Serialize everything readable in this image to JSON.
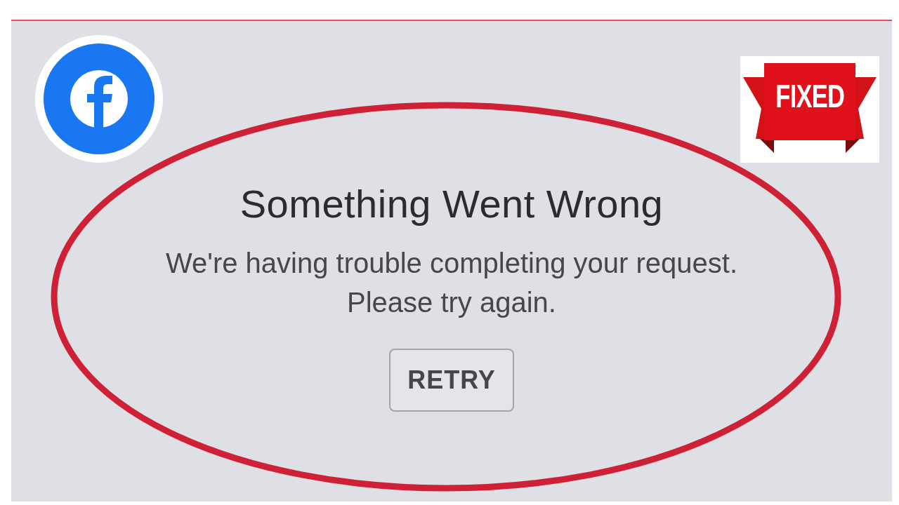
{
  "badge": {
    "text": "FIXED"
  },
  "error": {
    "title": "Something Went Wrong",
    "message_lines": [
      "We're having trouble completing your request.",
      "Please try again."
    ],
    "button": "RETRY"
  }
}
